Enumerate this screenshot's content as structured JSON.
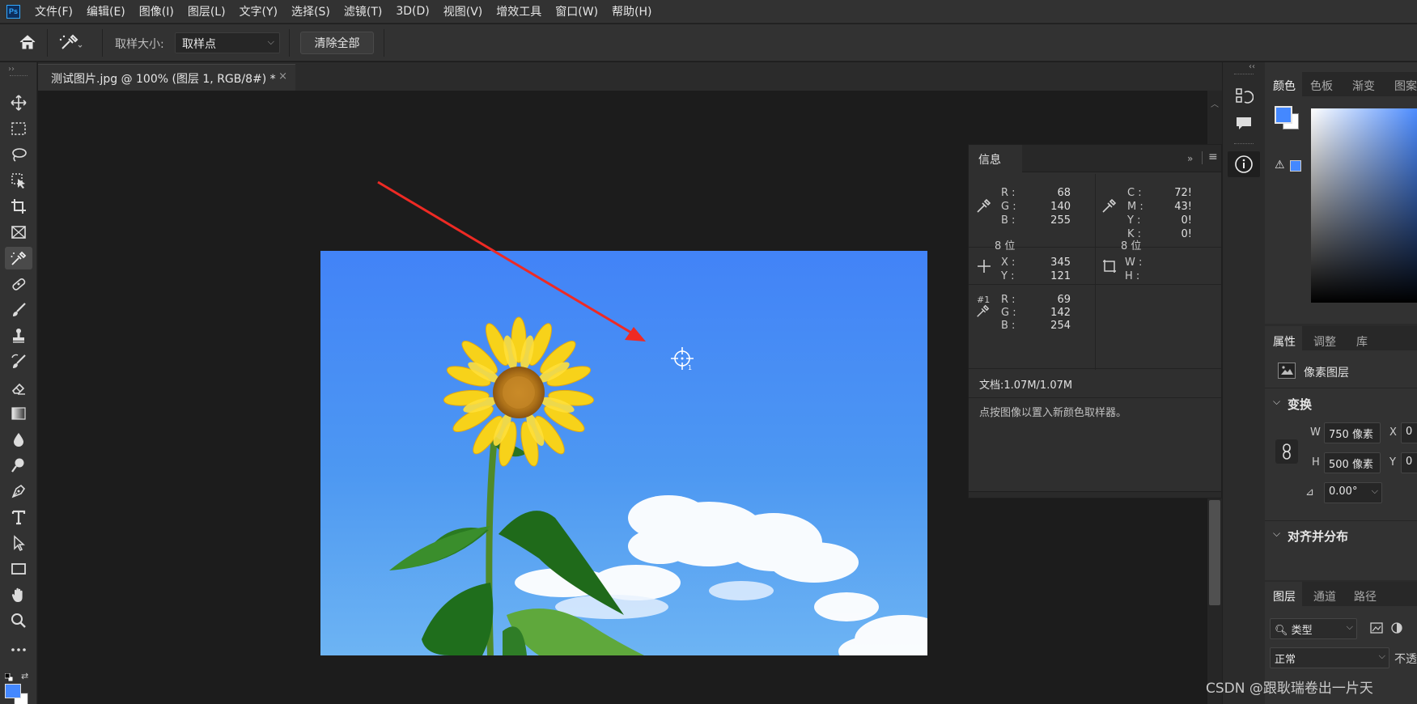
{
  "menubar": {
    "logo": "Ps",
    "items": [
      "文件(F)",
      "编辑(E)",
      "图像(I)",
      "图层(L)",
      "文字(Y)",
      "选择(S)",
      "滤镜(T)",
      "3D(D)",
      "视图(V)",
      "增效工具",
      "窗口(W)",
      "帮助(H)"
    ]
  },
  "options": {
    "sample_size_label": "取样大小:",
    "sample_size_value": "取样点",
    "clear_all_label": "清除全部"
  },
  "document": {
    "tab_title": "测试图片.jpg @ 100% (图层 1, RGB/8#) *",
    "close_glyph": "×"
  },
  "info_panel": {
    "tab_label": "信息",
    "rgb_labels": [
      "R :",
      "G :",
      "B :"
    ],
    "rgb_values": [
      "68",
      "140",
      "255"
    ],
    "bit_depth_left": "8 位",
    "cmyk_labels": [
      "C :",
      "M :",
      "Y :",
      "K :"
    ],
    "cmyk_values": [
      "72!",
      "43!",
      "0!",
      "0!"
    ],
    "bit_depth_right": "8 位",
    "xy_labels": [
      "X :",
      "Y :"
    ],
    "xy_values": [
      "345",
      "121"
    ],
    "wh_labels": [
      "W :",
      "H :"
    ],
    "sampler_id": "#1",
    "sampler_labels": [
      "R :",
      "G :",
      "B :"
    ],
    "sampler_values": [
      "69",
      "142",
      "254"
    ],
    "doc_size": "文档:1.07M/1.07M",
    "hint": "点按图像以置入新颜色取样器。"
  },
  "color_panel": {
    "tabs": [
      "颜色",
      "色板",
      "渐变",
      "图案"
    ],
    "foreground_color": "#4488ff",
    "background_color": "#ffffff"
  },
  "properties_panel": {
    "tabs": [
      "属性",
      "调整",
      "库"
    ],
    "layer_type": "像素图层",
    "transform_header": "变换",
    "w_label": "W",
    "w_value": "750 像素",
    "h_label": "H",
    "h_value": "500 像素",
    "x_label": "X",
    "x_value": "0",
    "y_label": "Y",
    "y_value": "0",
    "angle_value": "0.00°",
    "align_header": "对齐并分布"
  },
  "layers_panel": {
    "tabs": [
      "图层",
      "通道",
      "路径"
    ],
    "filter_value": "类型",
    "blend_mode": "正常",
    "opacity_label": "不透"
  },
  "watermark": "CSDN @跟耿瑞卷出一片天"
}
